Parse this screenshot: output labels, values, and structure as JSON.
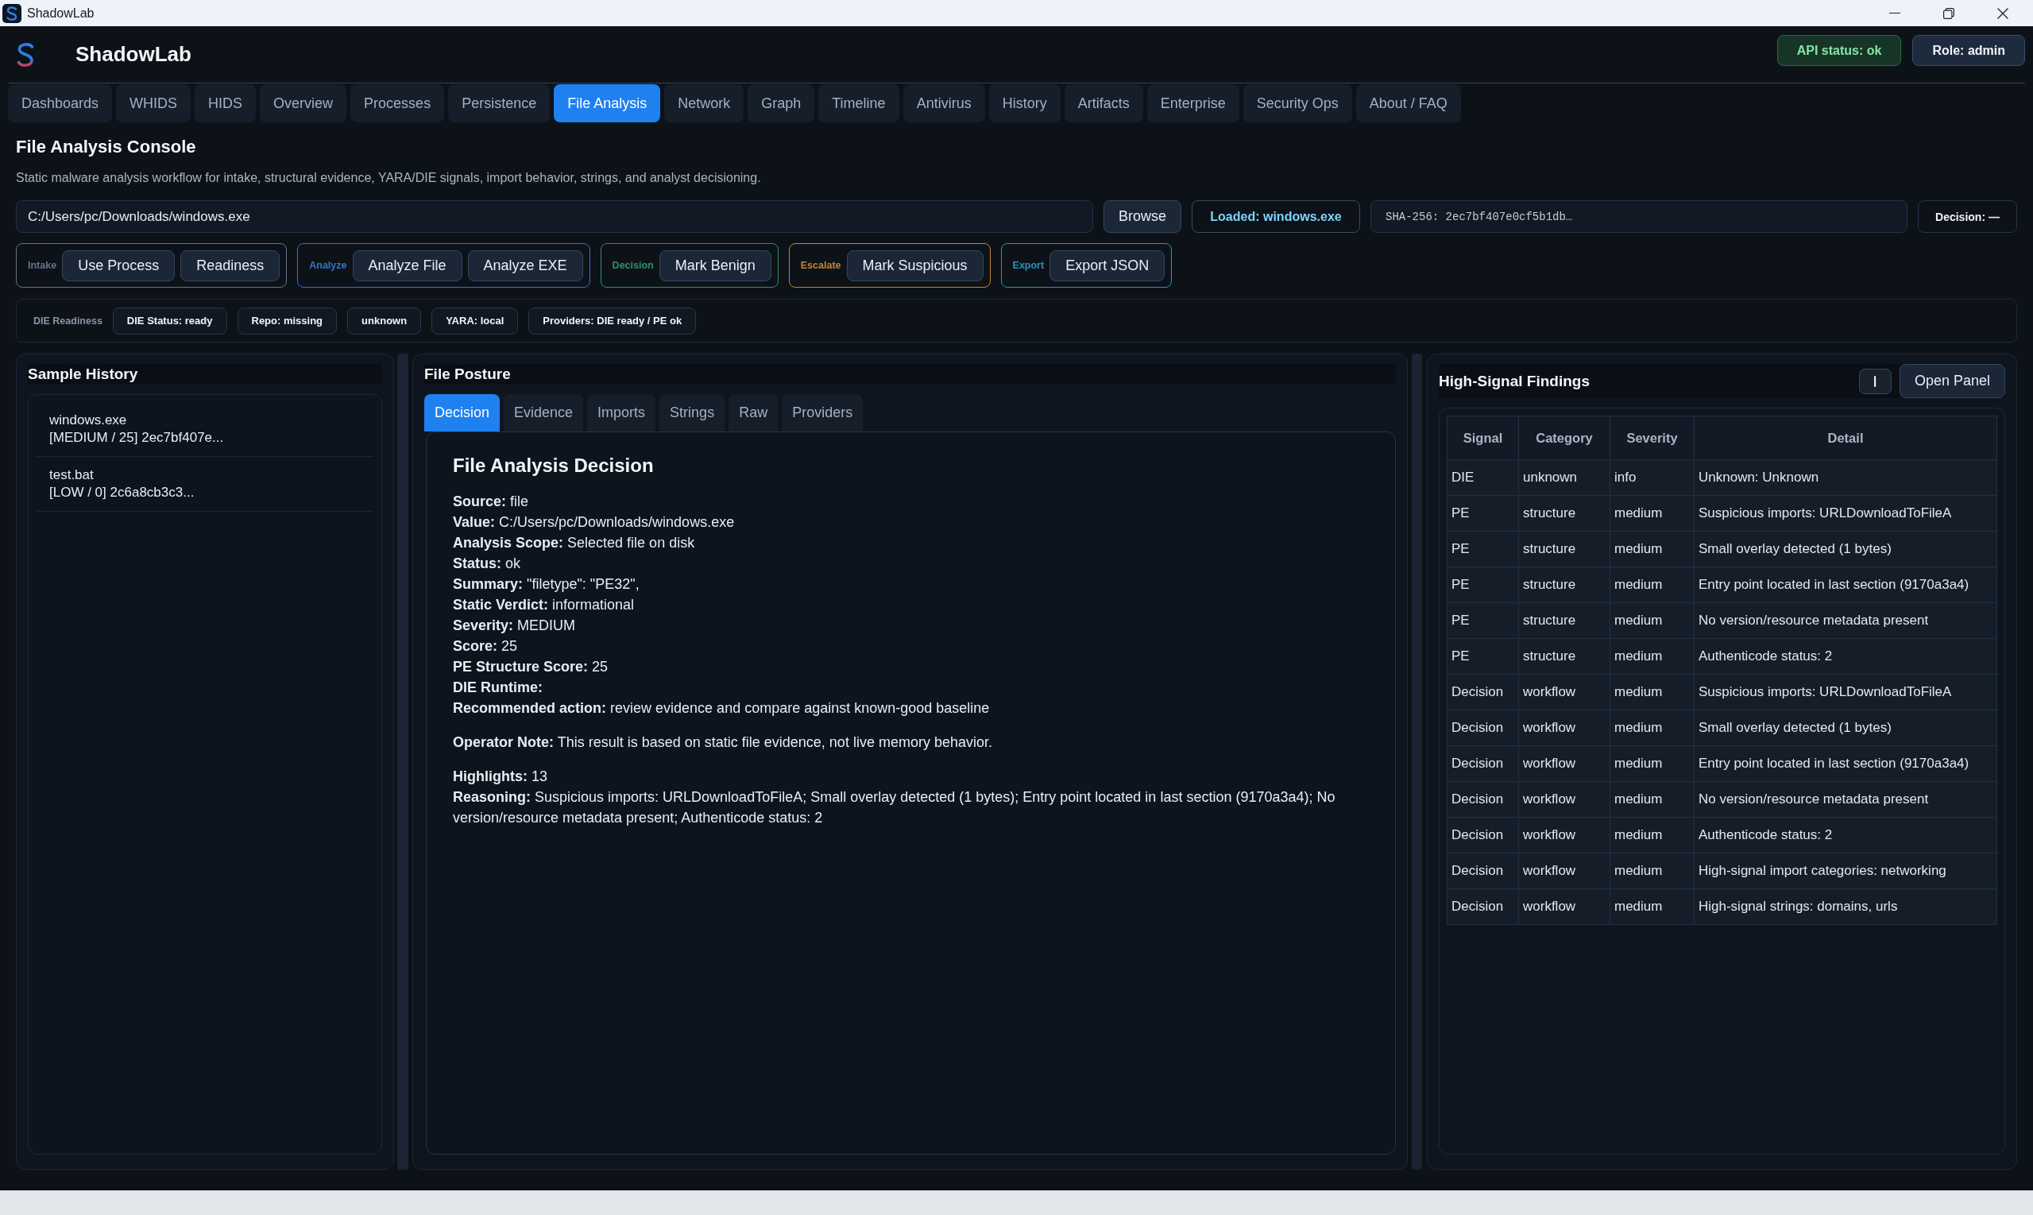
{
  "window": {
    "title": "ShadowLab"
  },
  "app": {
    "name": "ShadowLab"
  },
  "header_badges": [
    {
      "label": "API status: ok",
      "kind": "status"
    },
    {
      "label": "Role: admin",
      "kind": "role"
    }
  ],
  "tabs": [
    {
      "label": "Dashboards",
      "selected": false
    },
    {
      "label": "WHIDS",
      "selected": false
    },
    {
      "label": "HIDS",
      "selected": false
    },
    {
      "label": "Overview",
      "selected": false
    },
    {
      "label": "Processes",
      "selected": false
    },
    {
      "label": "Persistence",
      "selected": false
    },
    {
      "label": "File Analysis",
      "selected": true
    },
    {
      "label": "Network",
      "selected": false
    },
    {
      "label": "Graph",
      "selected": false
    },
    {
      "label": "Timeline",
      "selected": false
    },
    {
      "label": "Antivirus",
      "selected": false
    },
    {
      "label": "History",
      "selected": false
    },
    {
      "label": "Artifacts",
      "selected": false
    },
    {
      "label": "Enterprise",
      "selected": false
    },
    {
      "label": "Security Ops",
      "selected": false
    },
    {
      "label": "About / FAQ",
      "selected": false
    }
  ],
  "page": {
    "title": "File Analysis Console",
    "description": "Static malware analysis workflow for intake, structural evidence, YARA/DIE signals, import behavior, strings, and analyst decisioning."
  },
  "file_bar": {
    "path": {
      "value": "C:/Users/pc/Downloads/windows.exe"
    },
    "browse_button": "Browse",
    "loaded": "Loaded: windows.exe",
    "sha256": "SHA-256: 2ec7bf407e0cf5b1db…",
    "decision": "Decision: —"
  },
  "action_groups": [
    {
      "label": "Intake",
      "color": "#66738a",
      "buttons": [
        "Use Process",
        "Readiness"
      ]
    },
    {
      "label": "Analyze",
      "color": "#3674c0",
      "buttons": [
        "Analyze File",
        "Analyze EXE"
      ]
    },
    {
      "label": "Decision",
      "color": "#2e9263",
      "buttons": [
        "Mark Benign"
      ]
    },
    {
      "label": "Escalate",
      "color": "#c78332",
      "buttons": [
        "Mark Suspicious"
      ]
    },
    {
      "label": "Export",
      "color": "#2b93ba",
      "buttons": [
        "Export JSON"
      ]
    }
  ],
  "readiness": {
    "label": "DIE Readiness",
    "chips": [
      "DIE Status: ready",
      "Repo: missing",
      "unknown",
      "YARA: local",
      "Providers: DIE ready / PE ok"
    ]
  },
  "sample_history": {
    "title": "Sample History",
    "items": [
      {
        "name": "windows.exe",
        "summary": "[MEDIUM / 25] 2ec7bf407e...",
        "selected": false
      },
      {
        "name": "test.bat",
        "summary": "[LOW / 0] 2c6a8cb3c3...",
        "selected": false
      }
    ]
  },
  "file_posture": {
    "title": "File Posture",
    "tabs": [
      {
        "label": "Decision",
        "selected": true
      },
      {
        "label": "Evidence",
        "selected": false
      },
      {
        "label": "Imports",
        "selected": false
      },
      {
        "label": "Strings",
        "selected": false
      },
      {
        "label": "Raw",
        "selected": false
      },
      {
        "label": "Providers",
        "selected": false
      }
    ],
    "decision": {
      "title": "File Analysis Decision",
      "sections": [
        [
          "**Source:** file",
          "**Value:** C:/Users/pc/Downloads/windows.exe",
          "**Analysis Scope:** Selected file on disk",
          "**Status:** ok",
          "**Summary:** \"filetype\": \"PE32\",",
          "**Static Verdict:** informational",
          "**Severity:** MEDIUM",
          "**Score:** 25",
          "**PE Structure Score:** 25",
          "**DIE Runtime:**",
          "**Recommended action:** review evidence and compare against known-good baseline"
        ],
        [
          "**Operator Note:** This result is based on static file evidence, not live memory behavior."
        ],
        [
          "**Highlights:** 13",
          "**Reasoning:** Suspicious imports: URLDownloadToFileA; Small overlay detected (1 bytes); Entry point located in last section (9170a3a4); No version/resource metadata present; Authenticode status: 2"
        ]
      ]
    }
  },
  "findings": {
    "title": "High-Signal Findings",
    "open_button": "Open Panel",
    "columns": [
      "Signal",
      "Category",
      "Severity",
      "Detail"
    ],
    "rows": [
      [
        "DIE",
        "unknown",
        "info",
        "Unknown: Unknown"
      ],
      [
        "PE",
        "structure",
        "medium",
        "Suspicious imports: URLDownloadToFileA"
      ],
      [
        "PE",
        "structure",
        "medium",
        "Small overlay detected (1 bytes)"
      ],
      [
        "PE",
        "structure",
        "medium",
        "Entry point located in last section (9170a3a4)"
      ],
      [
        "PE",
        "structure",
        "medium",
        "No version/resource metadata present"
      ],
      [
        "PE",
        "structure",
        "medium",
        "Authenticode status: 2"
      ],
      [
        "Decision",
        "workflow",
        "medium",
        "Suspicious imports: URLDownloadToFileA"
      ],
      [
        "Decision",
        "workflow",
        "medium",
        "Small overlay detected (1 bytes)"
      ],
      [
        "Decision",
        "workflow",
        "medium",
        "Entry point located in last section (9170a3a4)"
      ],
      [
        "Decision",
        "workflow",
        "medium",
        "No version/resource metadata present"
      ],
      [
        "Decision",
        "workflow",
        "medium",
        "Authenticode status: 2"
      ],
      [
        "Decision",
        "workflow",
        "medium",
        "High-signal import categories: networking"
      ],
      [
        "Decision",
        "workflow",
        "medium",
        "High-signal strings: domains, urls"
      ]
    ]
  }
}
